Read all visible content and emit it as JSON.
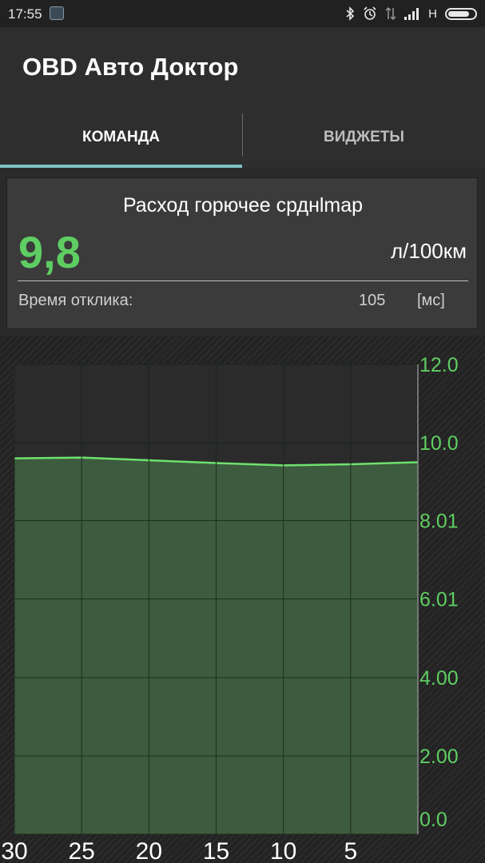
{
  "status_bar": {
    "time": "17:55",
    "network_label": "H",
    "icons": [
      "app-thumbnail-icon",
      "bluetooth-icon",
      "alarm-icon",
      "data-transfer-icon",
      "signal-icon",
      "battery-icon"
    ]
  },
  "app": {
    "title": "OBD Авто Доктор"
  },
  "tabs": [
    {
      "label": "КОМАНДА",
      "active": true
    },
    {
      "label": "ВИДЖЕТЫ",
      "active": false
    }
  ],
  "reading": {
    "title": "Расход горючее срднlmap",
    "value": "9,8",
    "unit": "л/100км",
    "response_label": "Время отклика:",
    "response_value": "105",
    "response_unit": "[мс]"
  },
  "colors": {
    "accent_green": "#5fce62",
    "tab_indicator": "#7fc1c4",
    "fill_green": "#3d5b3e",
    "line_green": "#6ee16e"
  },
  "chart_data": {
    "type": "area",
    "x": [
      30,
      25,
      20,
      15,
      10,
      5,
      0
    ],
    "x_tick_labels": [
      "30",
      "25",
      "20",
      "15",
      "10",
      "5"
    ],
    "values": [
      9.6,
      9.62,
      9.55,
      9.48,
      9.42,
      9.45,
      9.5
    ],
    "y_tick_labels": [
      "12.0",
      "10.0",
      "8.01",
      "6.01",
      "4.00",
      "2.00",
      "0.0"
    ],
    "y_ticks": [
      12.0,
      10.0,
      8.01,
      6.01,
      4.0,
      2.0,
      0.0
    ],
    "ylim": [
      0,
      12
    ],
    "xlim": [
      30,
      0
    ],
    "grid": true,
    "title": "",
    "xlabel": "",
    "ylabel": ""
  }
}
